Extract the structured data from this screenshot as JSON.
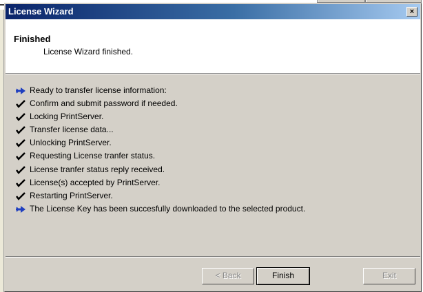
{
  "window": {
    "title": "License Wizard",
    "close_glyph": "×"
  },
  "header": {
    "title": "Finished",
    "subtitle": "License Wizard finished."
  },
  "steps": [
    {
      "icon": "arrow-right-icon",
      "text": "Ready to transfer license information:"
    },
    {
      "icon": "checkmark-icon",
      "text": "Confirm and submit password if needed."
    },
    {
      "icon": "checkmark-icon",
      "text": "Locking PrintServer."
    },
    {
      "icon": "checkmark-icon",
      "text": "Transfer license data..."
    },
    {
      "icon": "checkmark-icon",
      "text": "Unlocking PrintServer."
    },
    {
      "icon": "checkmark-icon",
      "text": "Requesting License tranfer status."
    },
    {
      "icon": "checkmark-icon",
      "text": "License tranfer status reply received."
    },
    {
      "icon": "checkmark-icon",
      "text": "License(s) accepted by PrintServer."
    },
    {
      "icon": "checkmark-icon",
      "text": "Restarting PrintServer."
    },
    {
      "icon": "arrow-right-icon",
      "text": "The License Key has been succesfully downloaded to the selected product."
    }
  ],
  "buttons": {
    "back": "< Back",
    "finish": "Finish",
    "exit": "Exit"
  },
  "colors": {
    "arrow": "#1f3fbf",
    "check": "#000000"
  }
}
